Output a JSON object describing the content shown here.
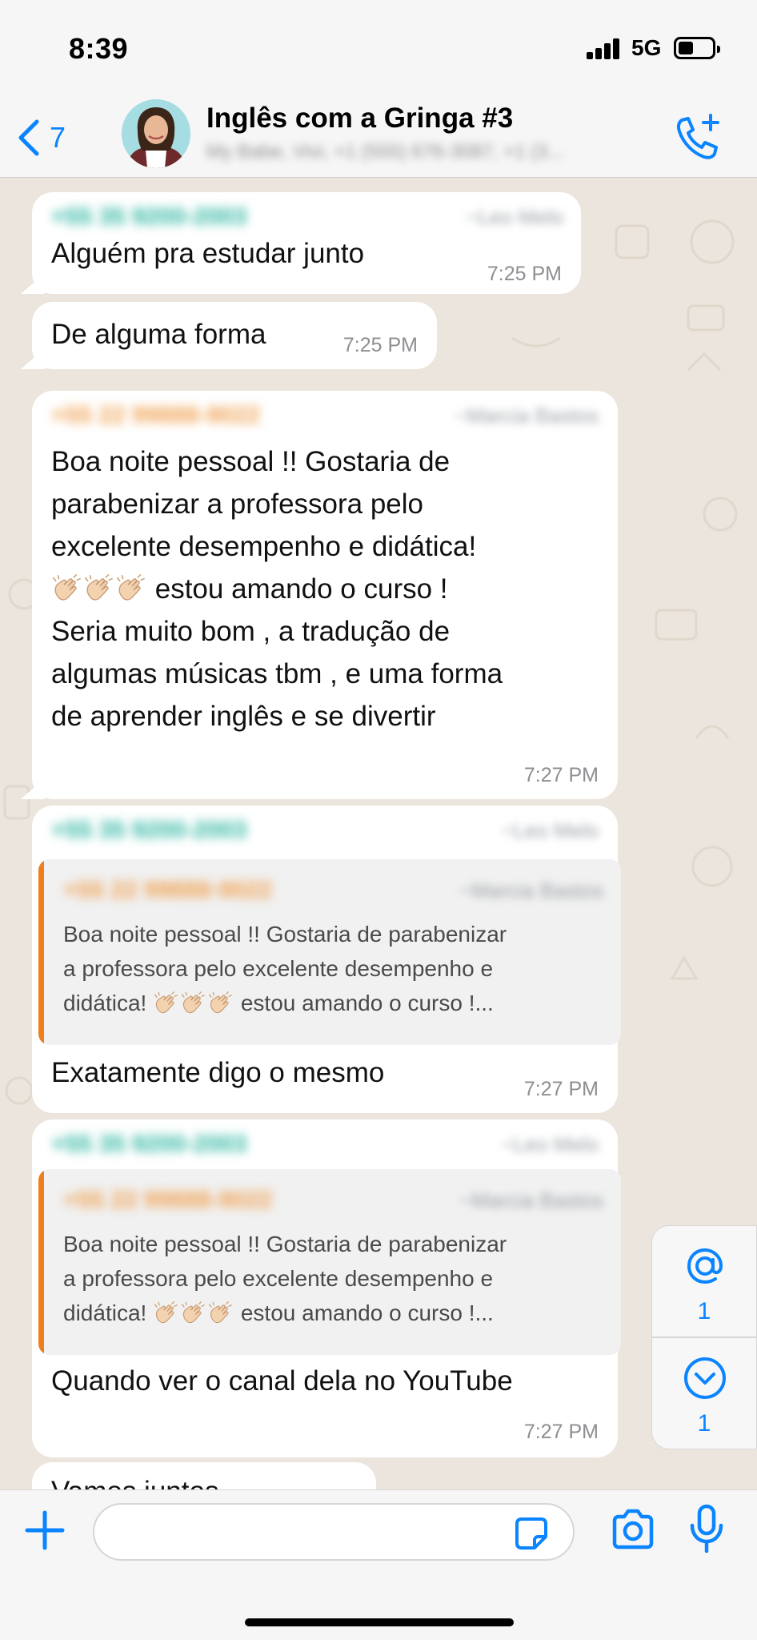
{
  "status_bar": {
    "time": "8:39",
    "network": "5G"
  },
  "header": {
    "back_count": "7",
    "title": "Inglês com a Gringa #3",
    "subtitle": "My Babe, Vivi, +1 (555) 676-3087, +1 (3..."
  },
  "messages": [
    {
      "sender": "+55 35 9200-2003",
      "alias": "~Leo Melo",
      "lines": [
        "Alguém pra estudar junto"
      ],
      "time": "7:25 PM"
    },
    {
      "lines": [
        "De alguma forma"
      ],
      "time": "7:25 PM"
    },
    {
      "sender": "+55 22 99888-9022",
      "alias": "~Marcia Bastos",
      "lines": [
        "Boa noite pessoal !! Gostaria de",
        "parabenizar a professora pelo",
        "excelente desempenho e didática!",
        "estou amando o curso !",
        "Seria muito bom , a tradução de",
        "algumas músicas tbm , e uma forma",
        "de aprender inglês e se divertir"
      ],
      "time": "7:27 PM"
    },
    {
      "sender": "+55 35 9200-2003",
      "alias": "~Leo Melo",
      "quote": {
        "sender": "+55 22 99888-9022",
        "alias": "~Marcia Bastos",
        "lines": [
          "Boa noite pessoal !! Gostaria de parabenizar",
          "a professora pelo excelente desempenho e",
          "didática!",
          "estou amando o curso !..."
        ]
      },
      "lines": [
        "Exatamente digo o mesmo"
      ],
      "time": "7:27 PM"
    },
    {
      "sender": "+55 35 9200-2003",
      "alias": "~Leo Melo",
      "quote": {
        "sender": "+55 22 99888-9022",
        "alias": "~Marcia Bastos",
        "lines": [
          "Boa noite pessoal !! Gostaria de parabenizar",
          "a professora pelo excelente desempenho e",
          "didática!",
          "estou amando o curso !..."
        ]
      },
      "lines": [
        "Quando ver o canal dela no YouTube"
      ],
      "time": "7:27 PM"
    },
    {
      "lines": [
        "Vamos juntos"
      ]
    }
  ],
  "jump_buttons": {
    "mentions_count": "1",
    "unread_count": "1"
  },
  "icons": {
    "back": "chevron-left-icon",
    "call": "phone-plus-icon",
    "attach": "plus-icon",
    "sticker": "sticker-icon",
    "camera": "camera-icon",
    "mic": "microphone-icon",
    "mention": "at-sign-icon",
    "scroll_down": "chevron-down-circle-icon",
    "clap": "clapping-hands-icon"
  },
  "colors": {
    "accent": "#0a84ff",
    "chat_background": "#ece5dd",
    "quote_bar": "#ee7e1e",
    "sender_teal": "#2bb5a0",
    "sender_orange": "#f0a050"
  }
}
